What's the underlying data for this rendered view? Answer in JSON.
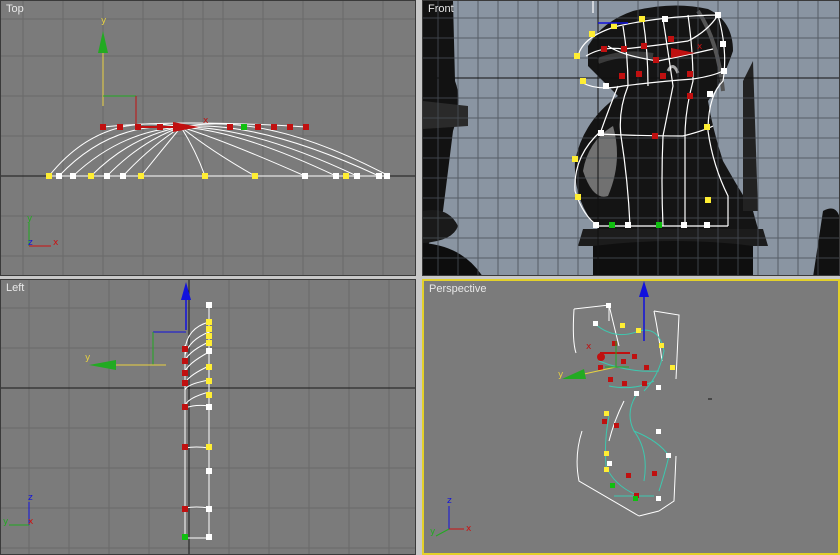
{
  "viewports": {
    "top": {
      "label": "Top"
    },
    "front": {
      "label": "Front"
    },
    "left": {
      "label": "Left"
    },
    "perspective": {
      "label": "Perspective",
      "active": true
    }
  },
  "axes": {
    "x": "x",
    "y": "y",
    "z": "z"
  },
  "colors": {
    "viewport_bg": "#7b7b7b",
    "grid_line": "#6b6b6b",
    "world_axis": "#1a1a1a",
    "front_bg": "#8a95a2",
    "active_border": "#e3d12a",
    "spline": "#ffffff",
    "vertex_white": "#ffffff",
    "vertex_yellow": "#ffee33",
    "vertex_red": "#c01010",
    "vertex_green": "#10c010",
    "axis_x": "#cc1111",
    "axis_y": "#22aa22",
    "axis_z": "#1111dd",
    "axis_label": "#e8d240"
  },
  "icons": {
    "move_gizmo": "transform-gizmo-icon",
    "axis_tripod": "axis-tripod-icon"
  }
}
